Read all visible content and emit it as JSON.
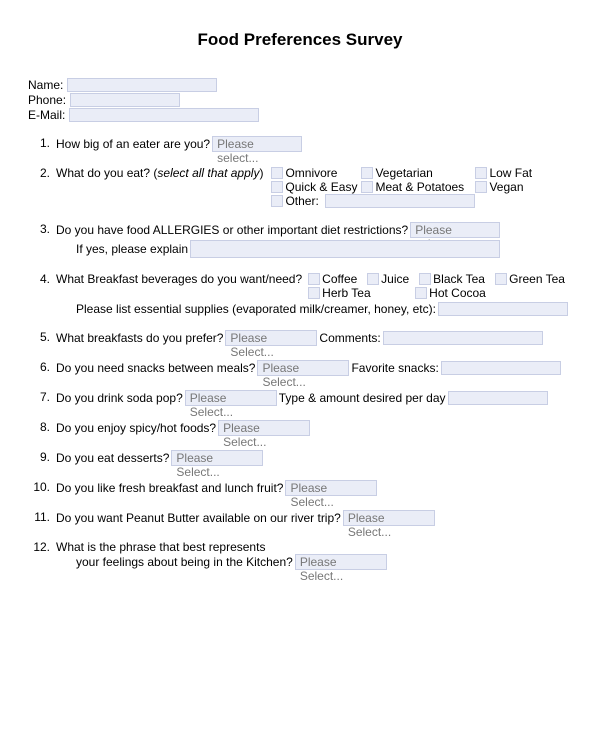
{
  "title": "Food Preferences Survey",
  "header": {
    "name": "Name:",
    "phone": "Phone:",
    "email": "E-Mail:"
  },
  "placeholders": {
    "select": "Please select...",
    "select2": "Please Select..."
  },
  "q1": {
    "num": "1.",
    "text": "How big of an eater are you?"
  },
  "q2": {
    "num": "2.",
    "text": "What do you eat? (",
    "apply": "select all that apply",
    "close": ")",
    "opts": [
      "Omnivore",
      "Vegetarian",
      "Low Fat",
      "Quick & Easy",
      "Meat & Potatoes",
      "Vegan",
      "Other:"
    ]
  },
  "q3": {
    "num": "3.",
    "text": "Do you have food ALLERGIES or other important diet restrictions?",
    "sub": "If yes, please explain"
  },
  "q4": {
    "num": "4.",
    "text": "What Breakfast beverages do you want/need?",
    "opts": [
      "Coffee",
      "Juice",
      "Black Tea",
      "Green Tea",
      "Herb Tea",
      "Hot Cocoa"
    ],
    "sub": "Please list essential supplies (evaporated milk/creamer, honey, etc):"
  },
  "q5": {
    "num": "5.",
    "text": "What breakfasts do you prefer?",
    "after": "Comments:"
  },
  "q6": {
    "num": "6.",
    "text": "Do you need snacks between meals?",
    "after": "Favorite snacks:"
  },
  "q7": {
    "num": "7.",
    "text": "Do you drink soda pop?",
    "after": "Type & amount desired per day"
  },
  "q8": {
    "num": "8.",
    "text": "Do you enjoy spicy/hot foods?"
  },
  "q9": {
    "num": "9.",
    "text": "Do you eat desserts?"
  },
  "q10": {
    "num": "10.",
    "text": "Do you like fresh breakfast and lunch fruit?"
  },
  "q11": {
    "num": "11.",
    "text": "Do you want Peanut Butter available on our river trip?"
  },
  "q12": {
    "num": "12.",
    "text1": "What is the phrase that best represents",
    "text2": "your feelings about being in the Kitchen?"
  }
}
